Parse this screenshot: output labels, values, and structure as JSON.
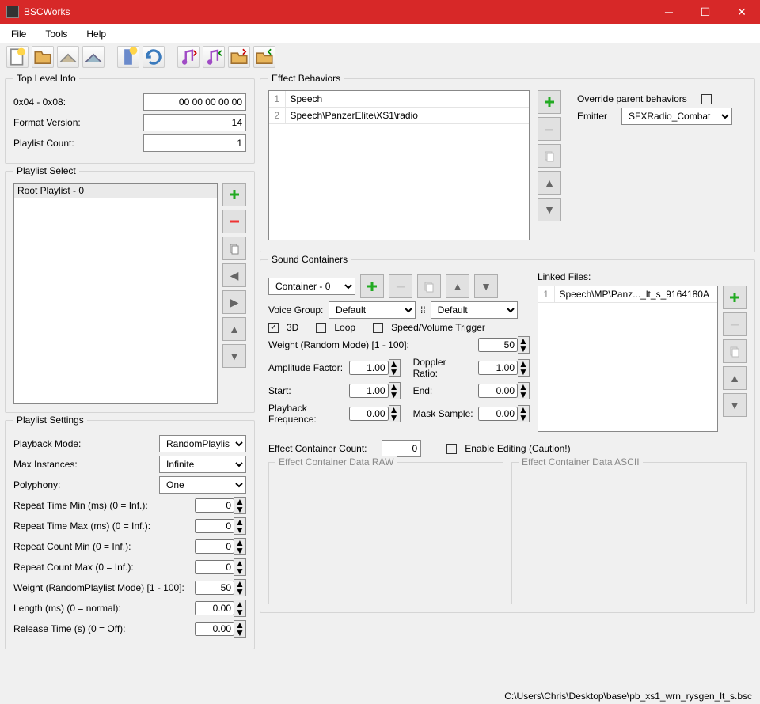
{
  "app": {
    "title": "BSCWorks"
  },
  "menu": [
    "File",
    "Tools",
    "Help"
  ],
  "topLevel": {
    "legend": "Top Level Info",
    "hex_label": "0x04 - 0x08:",
    "hex_value": "00 00 00 00 00",
    "format_label": "Format Version:",
    "format_value": "14",
    "playlist_label": "Playlist Count:",
    "playlist_value": "1"
  },
  "playlistSelect": {
    "legend": "Playlist Select",
    "items": [
      "Root Playlist - 0"
    ]
  },
  "playlistSettings": {
    "legend": "Playlist Settings",
    "playback_mode_label": "Playback Mode:",
    "playback_mode": "RandomPlaylist",
    "max_inst_label": "Max Instances:",
    "max_inst": "Infinite",
    "poly_label": "Polyphony:",
    "poly": "One",
    "rtmin_label": "Repeat Time Min (ms) (0 = Inf.):",
    "rtmin": "0",
    "rtmax_label": "Repeat Time Max (ms) (0 = Inf.):",
    "rtmax": "0",
    "rcmin_label": "Repeat Count Min (0 = Inf.):",
    "rcmin": "0",
    "rcmax_label": "Repeat Count Max (0 = Inf.):",
    "rcmax": "0",
    "weight_label": "Weight (RandomPlaylist Mode) [1 - 100]:",
    "weight": "50",
    "length_label": "Length (ms) (0 = normal):",
    "length": "0.00",
    "release_label": "Release Time (s) (0 = Off):",
    "release": "0.00"
  },
  "effectBehaviors": {
    "legend": "Effect Behaviors",
    "items": [
      {
        "n": "1",
        "t": "Speech"
      },
      {
        "n": "2",
        "t": "Speech\\PanzerElite\\XS1\\radio"
      }
    ],
    "override_label": "Override parent behaviors",
    "emitter_label": "Emitter",
    "emitter": "SFXRadio_Combat"
  },
  "soundContainers": {
    "legend": "Sound Containers",
    "container": "Container - 0",
    "voicegroup_label": "Voice Group:",
    "vg1": "Default",
    "vg2": "Default",
    "cb_3d": "3D",
    "cb_loop": "Loop",
    "cb_svt": "Speed/Volume Trigger",
    "weight_label": "Weight (Random Mode) [1 - 100]:",
    "weight": "50",
    "amp_label": "Amplitude Factor:",
    "amp": "1.00",
    "doppler_label": "Doppler Ratio:",
    "doppler": "1.00",
    "start_label": "Start:",
    "start": "1.00",
    "end_label": "End:",
    "end": "0.00",
    "freq_label": "Playback Frequence:",
    "freq": "0.00",
    "mask_label": "Mask Sample:",
    "mask": "0.00",
    "linked_label": "Linked Files:",
    "linked": [
      {
        "n": "1",
        "t": "Speech\\MP\\Panz..._lt_s_9164180A"
      }
    ],
    "ecc_label": "Effect Container Count:",
    "ecc": "0",
    "enable_label": "Enable Editing (Caution!)",
    "raw_label": "Effect Container Data RAW",
    "ascii_label": "Effect Container Data ASCII"
  },
  "status": "C:\\Users\\Chris\\Desktop\\base\\pb_xs1_wrn_rysgen_lt_s.bsc"
}
